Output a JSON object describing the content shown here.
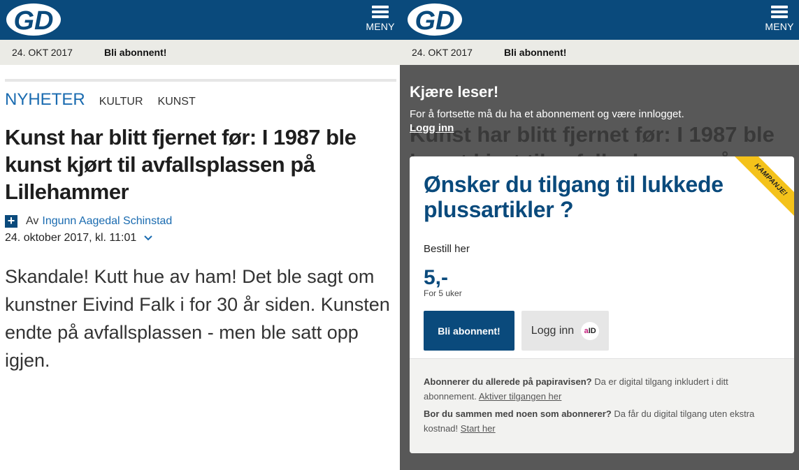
{
  "brand": {
    "logo_text": "GD",
    "color_primary": "#0a4a7c",
    "color_link": "#1a6bb0",
    "color_ribbon": "#f4c21a"
  },
  "header": {
    "menu_label": "MENY",
    "date": "24. OKT 2017",
    "subscribe_label": "Bli abonnent!"
  },
  "article": {
    "tags": [
      "NYHETER",
      "KULTUR",
      "KUNST"
    ],
    "headline": "Kunst har blitt fjernet før: I 1987 ble kunst kjørt til avfallsplassen på Lillehammer",
    "byline_prefix": "Av",
    "author": "Ingunn Aagedal Schinstad",
    "published": "24. oktober 2017, kl. 11:01",
    "lead": "Skandale! Kutt hue av ham! Det ble sagt om kunstner Eivind Falk i for 30 år siden. Kunsten endte på avfallsplassen - men ble satt opp igjen."
  },
  "paywall": {
    "greeting": "Kjære leser!",
    "message": "For å fortsette må du ha et abonnement og være innlogget.",
    "login_link": "Logg inn",
    "ribbon": "KAMPANJE!",
    "offer_title": "Ønsker du tilgang til lukkede plussartikler ?",
    "order_text": "Bestill her",
    "price": "5,-",
    "period": "For 5 uker",
    "subscribe_button": "Bli abonnent!",
    "login_button": "Logg inn",
    "aid_a": "a",
    "aid_id": "ID",
    "paper_q": "Abonnerer du allerede på papiravisen?",
    "paper_text": "Da er digital tilgang inkludert i ditt abonnement.",
    "paper_link": "Aktiver tilgangen her",
    "household_q": "Bor du sammen med noen som abonnerer?",
    "household_text": "Da får du digital tilgang uten ekstra kostnad!",
    "household_link": "Start her"
  }
}
